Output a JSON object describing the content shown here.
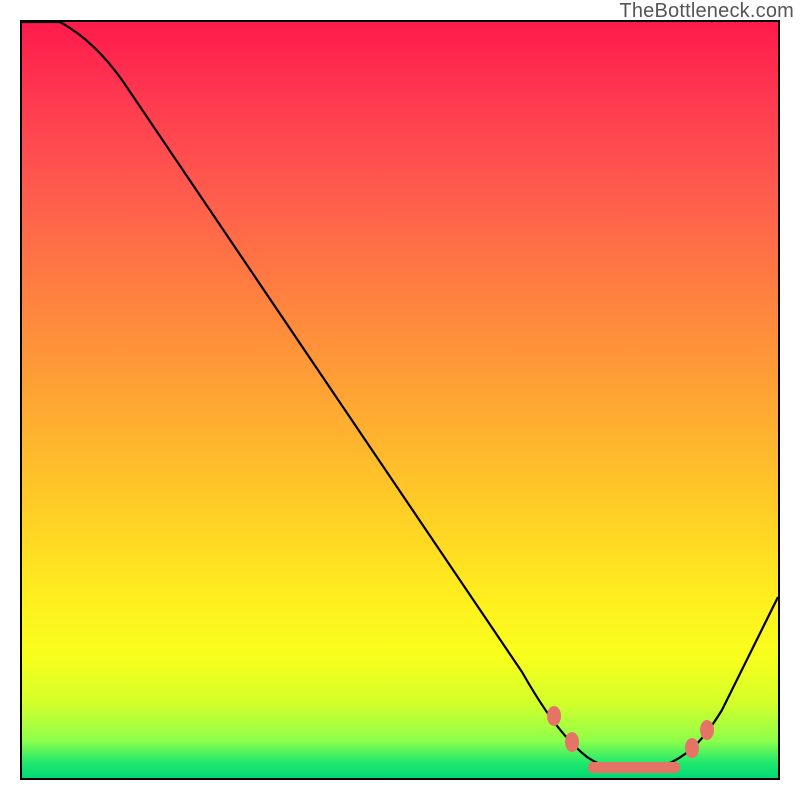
{
  "attribution": "TheBottleneck.com",
  "chart_data": {
    "type": "line",
    "title": "",
    "xlabel": "",
    "ylabel": "",
    "xlim": [
      0,
      100
    ],
    "ylim": [
      0,
      100
    ],
    "grid": false,
    "legend": false,
    "curve": [
      {
        "x": 0,
        "y": 100
      },
      {
        "x": 5,
        "y": 100
      },
      {
        "x": 8,
        "y": 98
      },
      {
        "x": 12,
        "y": 94
      },
      {
        "x": 20,
        "y": 83
      },
      {
        "x": 30,
        "y": 69
      },
      {
        "x": 40,
        "y": 55
      },
      {
        "x": 50,
        "y": 41
      },
      {
        "x": 60,
        "y": 27
      },
      {
        "x": 65,
        "y": 20
      },
      {
        "x": 70,
        "y": 10
      },
      {
        "x": 73,
        "y": 5
      },
      {
        "x": 76,
        "y": 2
      },
      {
        "x": 80,
        "y": 1
      },
      {
        "x": 84,
        "y": 1
      },
      {
        "x": 87,
        "y": 2
      },
      {
        "x": 90,
        "y": 5
      },
      {
        "x": 95,
        "y": 15
      },
      {
        "x": 100,
        "y": 25
      }
    ],
    "markers": [
      {
        "x": 71,
        "y": 9
      },
      {
        "x": 73,
        "y": 5
      },
      {
        "x": 89,
        "y": 4
      },
      {
        "x": 91,
        "y": 7
      }
    ],
    "bottom_segment": {
      "x0": 75,
      "x1": 87,
      "y": 1.2
    },
    "gradient_stops": [
      {
        "pos": 0,
        "color": "#ff1a4b"
      },
      {
        "pos": 50,
        "color": "#ffa633"
      },
      {
        "pos": 80,
        "color": "#f8ff1c"
      },
      {
        "pos": 100,
        "color": "#00d873"
      }
    ]
  }
}
